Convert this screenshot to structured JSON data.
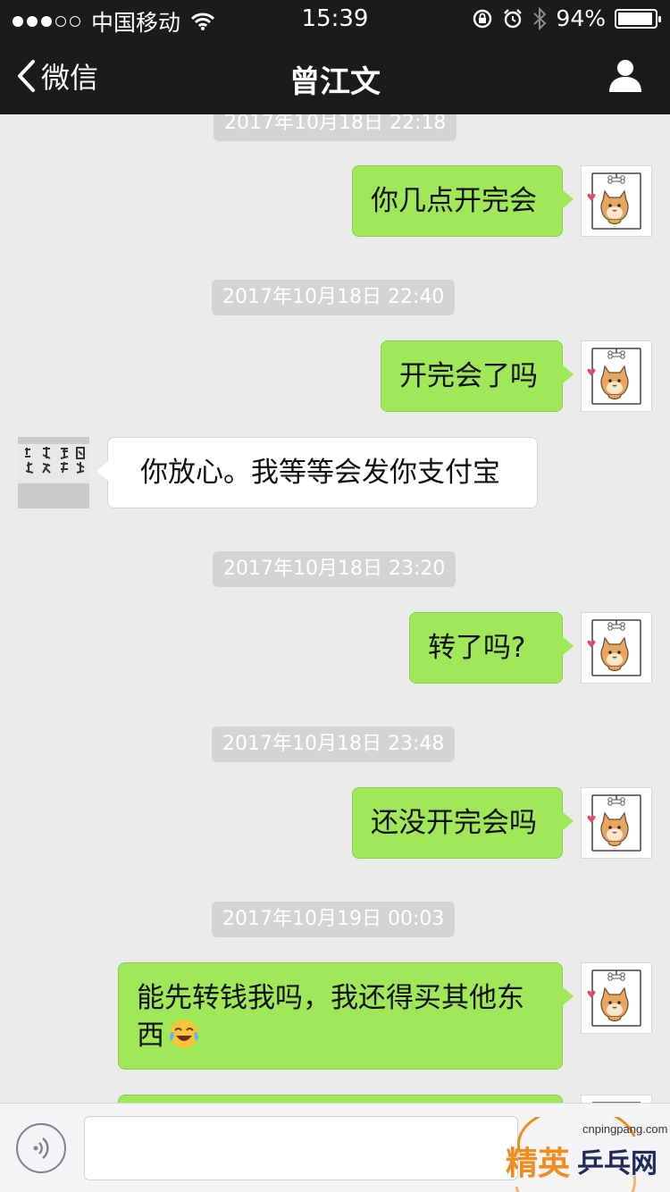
{
  "status_bar": {
    "carrier": "中国移动",
    "time": "15:39",
    "battery_text": "94%",
    "battery_level": 0.94
  },
  "nav": {
    "back_label": "微信",
    "title": "曾江文"
  },
  "messages": [
    {
      "type": "timestamp",
      "text": "2017年10月18日 22:18"
    },
    {
      "type": "sent",
      "text": "你几点开完会"
    },
    {
      "type": "timestamp",
      "text": "2017年10月18日 22:40"
    },
    {
      "type": "sent",
      "text": "开完会了吗"
    },
    {
      "type": "received",
      "text": "你放心。我等等会发你支付宝"
    },
    {
      "type": "timestamp",
      "text": "2017年10月18日 23:20"
    },
    {
      "type": "sent",
      "text": "转了吗?"
    },
    {
      "type": "timestamp",
      "text": "2017年10月18日 23:48"
    },
    {
      "type": "sent",
      "text": "还没开完会吗"
    },
    {
      "type": "timestamp",
      "text": "2017年10月19日 00:03"
    },
    {
      "type": "sent",
      "text": "能先转钱我吗，我还得买其他东西",
      "emoji": "crying-laughing-emoji"
    },
    {
      "type": "sent",
      "text": ""
    }
  ],
  "watermark": {
    "url": "cnpingpang.com",
    "brand_left": "精英",
    "brand_right": "乒乓网"
  },
  "colors": {
    "nav_bg": "#1b1b1e",
    "chat_bg": "#ebebeb",
    "sent_bubble": "#a0e75a",
    "received_bubble": "#ffffff",
    "timestamp_bg": "#d4d4d4",
    "watermark_orange": "#f08c1e"
  }
}
